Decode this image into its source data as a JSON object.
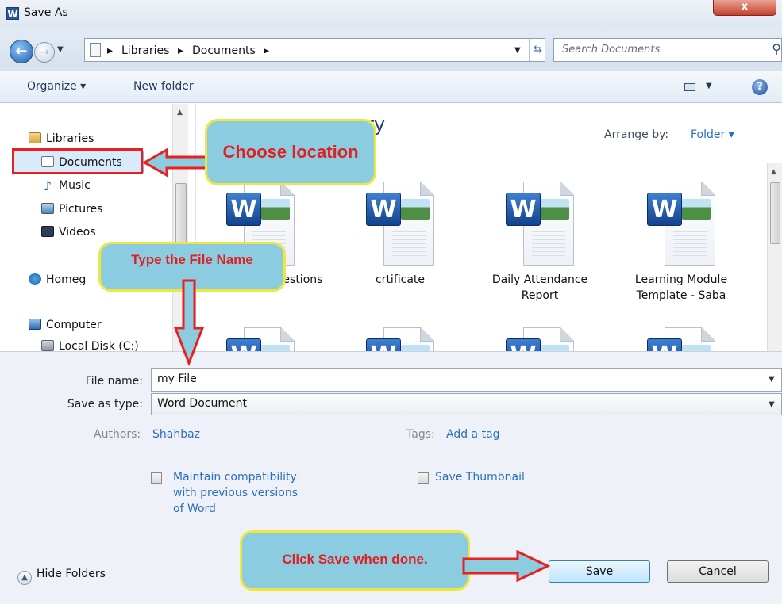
{
  "window": {
    "title": "Save As",
    "app_logo": "W",
    "close_label": "x"
  },
  "address": {
    "crumbs": [
      "Libraries",
      "Documents"
    ],
    "search_placeholder": "Search Documents"
  },
  "toolbar": {
    "organize": "Organize ▾",
    "new_folder": "New folder",
    "help": "?"
  },
  "nav": {
    "items": [
      {
        "label": "Libraries",
        "icon": "library-icon"
      },
      {
        "label": "Documents",
        "icon": "documents-icon"
      },
      {
        "label": "Music",
        "icon": "music-icon"
      },
      {
        "label": "Pictures",
        "icon": "pictures-icon"
      },
      {
        "label": "Videos",
        "icon": "videos-icon"
      },
      {
        "label": "Homeg",
        "icon": "homegroup-icon"
      },
      {
        "label": "Computer",
        "icon": "computer-icon"
      },
      {
        "label": "Local Disk (C:)",
        "icon": "disk-icon"
      }
    ]
  },
  "files": {
    "library_title": "ry",
    "arrange_label": "Arrange by:",
    "arrange_value": "Folder ▾",
    "items": [
      {
        "name": "...wer these Questions"
      },
      {
        "name": "crtificate"
      },
      {
        "name": "Daily Attendance Report"
      },
      {
        "name": "Learning Module Template - Saba"
      }
    ]
  },
  "form": {
    "filename_label": "File name:",
    "filename_value": "my File",
    "savetype_label": "Save as type:",
    "savetype_value": "Word Document",
    "authors_label": "Authors:",
    "authors_value": "Shahbaz",
    "tags_label": "Tags:",
    "tags_value": "Add a tag",
    "compat_label": "Maintain compatibility with previous versions of Word",
    "thumbnail_label": "Save Thumbnail",
    "hide_folders": "Hide Folders",
    "save": "Save",
    "cancel": "Cancel"
  },
  "annotations": {
    "choose_location": "Choose location",
    "type_file_name": "Type the File Name",
    "click_save": "Click Save when done.",
    "color_callout_bg": "#8bcce0",
    "color_callout_border": "#f0e640",
    "color_callout_text": "#e02020"
  }
}
